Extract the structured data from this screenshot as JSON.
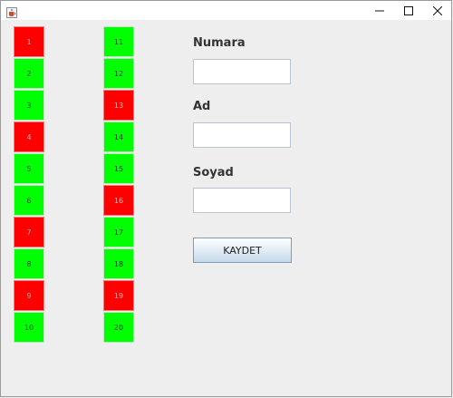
{
  "titlebar": {
    "icons": {
      "app": "java-cup-icon",
      "minimize": "minimize-icon",
      "maximize": "maximize-icon",
      "close": "close-icon"
    }
  },
  "seats": {
    "colors": {
      "free": "#00ff00",
      "taken": "#ff0000"
    },
    "left_column": [
      {
        "label": "1",
        "status": "taken"
      },
      {
        "label": "2",
        "status": "free"
      },
      {
        "label": "3",
        "status": "free"
      },
      {
        "label": "4",
        "status": "taken"
      },
      {
        "label": "5",
        "status": "free"
      },
      {
        "label": "6",
        "status": "free"
      },
      {
        "label": "7",
        "status": "taken"
      },
      {
        "label": "8",
        "status": "free"
      },
      {
        "label": "9",
        "status": "taken"
      },
      {
        "label": "10",
        "status": "free"
      }
    ],
    "right_column": [
      {
        "label": "11",
        "status": "free"
      },
      {
        "label": "12",
        "status": "free"
      },
      {
        "label": "13",
        "status": "taken"
      },
      {
        "label": "14",
        "status": "free"
      },
      {
        "label": "15",
        "status": "free"
      },
      {
        "label": "16",
        "status": "taken"
      },
      {
        "label": "17",
        "status": "free"
      },
      {
        "label": "18",
        "status": "free"
      },
      {
        "label": "19",
        "status": "taken"
      },
      {
        "label": "20",
        "status": "free"
      }
    ]
  },
  "form": {
    "numara_label": "Numara",
    "numara_value": "",
    "ad_label": "Ad",
    "ad_value": "",
    "soyad_label": "Soyad",
    "soyad_value": "",
    "save_label": "KAYDET"
  }
}
